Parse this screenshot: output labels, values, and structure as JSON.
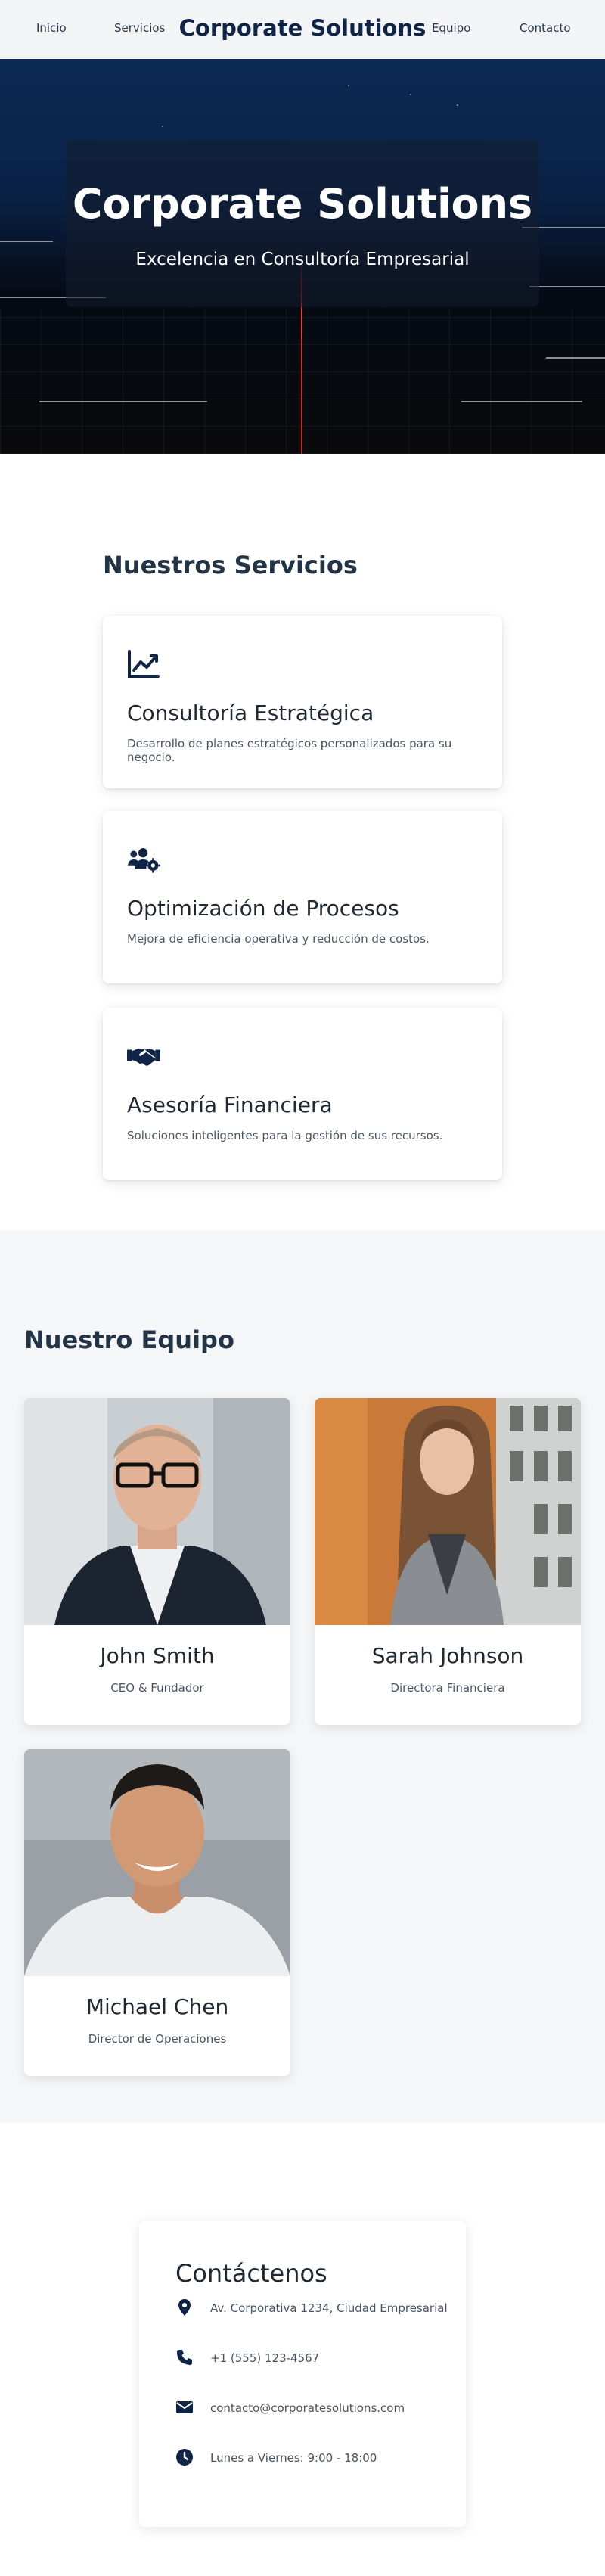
{
  "nav": {
    "links_left": [
      "Inicio",
      "Servicios"
    ],
    "brand": "Corporate Solutions",
    "links_right": [
      "Equipo",
      "Contacto"
    ]
  },
  "hero": {
    "title": "Corporate Solutions",
    "subtitle": "Excelencia en Consultoría Empresarial"
  },
  "services": {
    "title": "Nuestros Servicios",
    "items": [
      {
        "icon": "chart-line-icon",
        "title": "Consultoría Estratégica",
        "description": "Desarrollo de planes estratégicos personalizados para su negocio."
      },
      {
        "icon": "users-cog-icon",
        "title": "Optimización de Procesos",
        "description": "Mejora de eficiencia operativa y reducción de costos."
      },
      {
        "icon": "handshake-icon",
        "title": "Asesoría Financiera",
        "description": "Soluciones inteligentes para la gestión de sus recursos."
      }
    ]
  },
  "team": {
    "title": "Nuestro Equipo",
    "members": [
      {
        "name": "John Smith",
        "role": "CEO & Fundador"
      },
      {
        "name": "Sarah Johnson",
        "role": "Directora Financiera"
      },
      {
        "name": "Michael Chen",
        "role": "Director de Operaciones"
      }
    ]
  },
  "contact": {
    "title": "Contáctenos",
    "items": [
      {
        "icon": "location-pin-icon",
        "text": "Av. Corporativa 1234, Ciudad Empresarial"
      },
      {
        "icon": "phone-icon",
        "text": "+1 (555) 123-4567"
      },
      {
        "icon": "envelope-icon",
        "text": "contacto@corporatesolutions.com"
      },
      {
        "icon": "clock-icon",
        "text": "Lunes a Viernes: 9:00 - 18:00"
      }
    ]
  },
  "colors": {
    "navy": "#0f2446",
    "icon": "#0f2446",
    "accent_red": "#e23b3b"
  }
}
